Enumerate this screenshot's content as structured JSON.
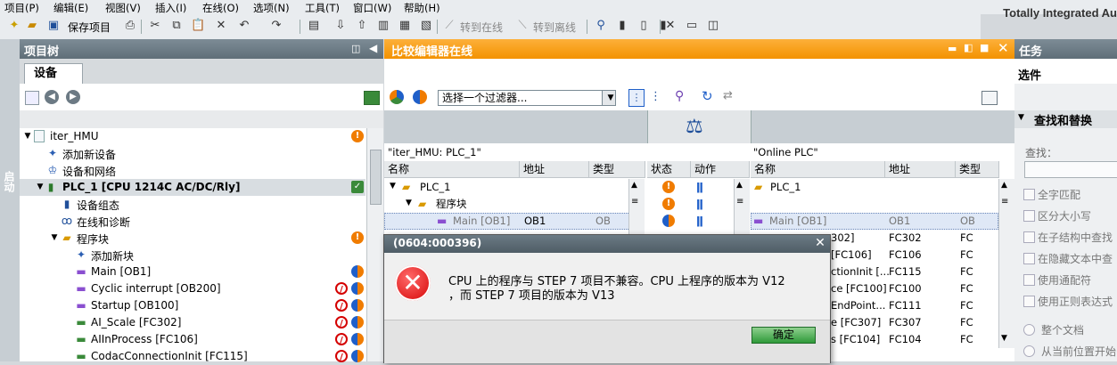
{
  "menu": [
    "项目(P)",
    "编辑(E)",
    "视图(V)",
    "插入(I)",
    "在线(O)",
    "选项(N)",
    "工具(T)",
    "窗口(W)",
    "帮助(H)"
  ],
  "brand": "Totally Integrated Au",
  "toolbar": {
    "save_project": "保存项目",
    "go_online": "转到在线",
    "go_offline": "转到离线"
  },
  "side_tab": "启动",
  "tree": {
    "title": "项目树",
    "tab": "设备",
    "rows": [
      {
        "label": "iter_HMU"
      },
      {
        "label": "添加新设备"
      },
      {
        "label": "设备和网络"
      },
      {
        "label": "PLC_1 [CPU 1214C AC/DC/Rly]"
      },
      {
        "label": "设备组态"
      },
      {
        "label": "在线和诊断"
      },
      {
        "label": "程序块"
      },
      {
        "label": "添加新块"
      },
      {
        "label": "Main [OB1]"
      },
      {
        "label": "Cyclic interrupt [OB200]"
      },
      {
        "label": "Startup [OB100]"
      },
      {
        "label": "AI_Scale [FC302]"
      },
      {
        "label": "AIInProcess [FC106]"
      },
      {
        "label": "CodacConnectionInit [FC115]"
      }
    ]
  },
  "compare": {
    "title": "比较编辑器在线",
    "filter_placeholder": "选择一个过滤器...",
    "left_label": "\"iter_HMU: PLC_1\"",
    "right_label": "\"Online PLC\"",
    "headers_left": [
      "名称",
      "地址",
      "类型"
    ],
    "headers_mid": [
      "状态",
      "动作"
    ],
    "headers_right": [
      "名称",
      "地址",
      "类型"
    ],
    "left_rows": [
      {
        "name": "PLC_1",
        "addr": "",
        "type": ""
      },
      {
        "name": "程序块",
        "addr": "",
        "type": ""
      },
      {
        "name": "Main [OB1]",
        "addr": "OB1",
        "type": "OB"
      }
    ],
    "right_rows": [
      {
        "name": "PLC_1",
        "addr": "",
        "type": ""
      },
      {
        "name": "",
        "addr": "",
        "type": ""
      },
      {
        "name": "Main [OB1]",
        "addr": "OB1",
        "type": "OB"
      },
      {
        "name": "302]",
        "addr": "FC302",
        "type": "FC"
      },
      {
        "name": "[FC106]",
        "addr": "FC106",
        "type": "FC"
      },
      {
        "name": "ctionInit [...",
        "addr": "FC115",
        "type": "FC"
      },
      {
        "name": "ce [FC100]",
        "addr": "FC100",
        "type": "FC"
      },
      {
        "name": "EndPoint...",
        "addr": "FC111",
        "type": "FC"
      },
      {
        "name": "e [FC307]",
        "addr": "FC307",
        "type": "FC"
      },
      {
        "name": "s [FC104]",
        "addr": "FC104",
        "type": "FC"
      }
    ]
  },
  "task": {
    "title": "任务",
    "section_options": "选件",
    "find_replace": "查找和替换",
    "find_label": "查找：",
    "options": [
      "全字匹配",
      "区分大小写",
      "在子结构中查找",
      "在隐藏文本中查",
      "使用通配符",
      "使用正则表达式"
    ],
    "radios": [
      "整个文档",
      "从当前位置开始"
    ]
  },
  "dialog": {
    "code": "(0604:000396)",
    "message_line1": "CPU 上的程序与 STEP 7 项目不兼容。CPU 上程序的版本为 V12",
    "message_line2": "，而 STEP 7 项目的版本为 V13",
    "ok": "确定"
  },
  "colors": {
    "accent_orange": "#f39200",
    "header_gray": "#6b7a84",
    "ok_green": "#2f9a3a",
    "error_red": "#d40000"
  }
}
